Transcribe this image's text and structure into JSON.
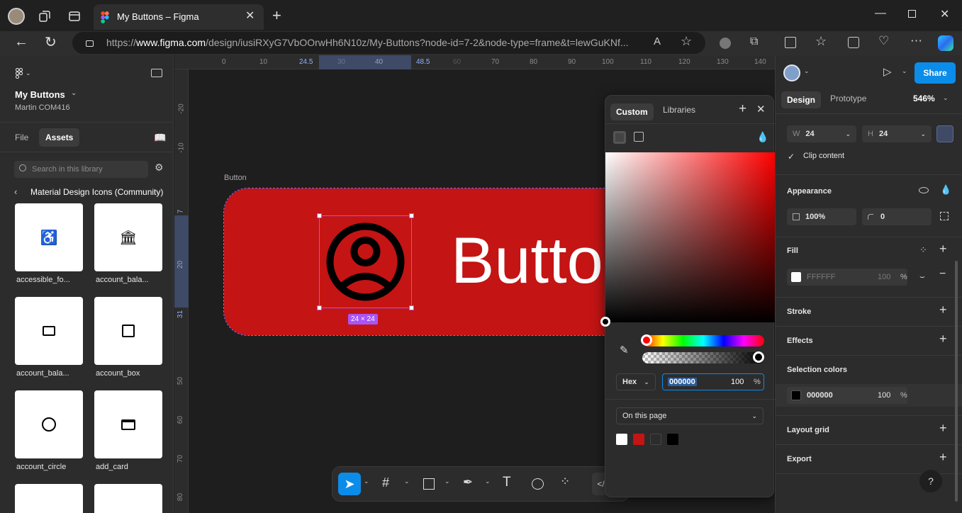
{
  "browser": {
    "tab_title": "My Buttons – Figma",
    "url_prefix": "https://",
    "url_domain": "www.figma.com",
    "url_rest": "/design/iusiRXyG7VbOOrwHh6N10z/My-Buttons?node-id=7-2&node-type=frame&t=lewGuKNf..."
  },
  "file": {
    "name": "My Buttons",
    "owner": "Martin COM416",
    "tabs": [
      "File",
      "Assets"
    ],
    "search_placeholder": "Search in this library",
    "library_title": "Material Design Icons (Community)",
    "assets": [
      {
        "label": "accessible_fo...",
        "icon": "accessible-icon"
      },
      {
        "label": "account_bala...",
        "icon": "bank-icon"
      },
      {
        "label": "account_bala...",
        "icon": "wallet-icon"
      },
      {
        "label": "account_box",
        "icon": "account-box-icon"
      },
      {
        "label": "account_circle",
        "icon": "account-circle-icon"
      },
      {
        "label": "add_card",
        "icon": "add-card-icon"
      }
    ]
  },
  "canvas": {
    "h_ticks": [
      "0",
      "10",
      "24.5",
      "30",
      "40",
      "48.5",
      "60",
      "70",
      "80",
      "90",
      "100",
      "110",
      "120",
      "130",
      "140"
    ],
    "v_ticks": [
      "-20",
      "-10",
      "7",
      "20",
      "31",
      "50",
      "60",
      "70",
      "80"
    ],
    "frame_label": "Button",
    "button_text": "Butto",
    "size_badge": "24 × 24",
    "button_color": "#c41414"
  },
  "picker": {
    "tabs": [
      "Custom",
      "Libraries"
    ],
    "format": "Hex",
    "hex_value": "000000",
    "opacity": "100",
    "percent": "%",
    "page_colors_label": "On this page",
    "swatches": [
      "#ffffff",
      "#c41414",
      "#2c2c2c",
      "#000000"
    ]
  },
  "right": {
    "share": "Share",
    "tabs": [
      "Design",
      "Prototype"
    ],
    "zoom": "546%",
    "w_label": "W",
    "w_value": "24",
    "h_label": "H",
    "h_value": "24",
    "clip_label": "Clip content",
    "appearance": "Appearance",
    "opacity": "100%",
    "radius": "0",
    "fill": "Fill",
    "fill_hex": "FFFFFF",
    "fill_opacity": "100",
    "stroke": "Stroke",
    "effects": "Effects",
    "selection_colors": "Selection colors",
    "sel_hex": "000000",
    "sel_opacity": "100",
    "layout_grid": "Layout grid",
    "export": "Export",
    "help": "?"
  }
}
